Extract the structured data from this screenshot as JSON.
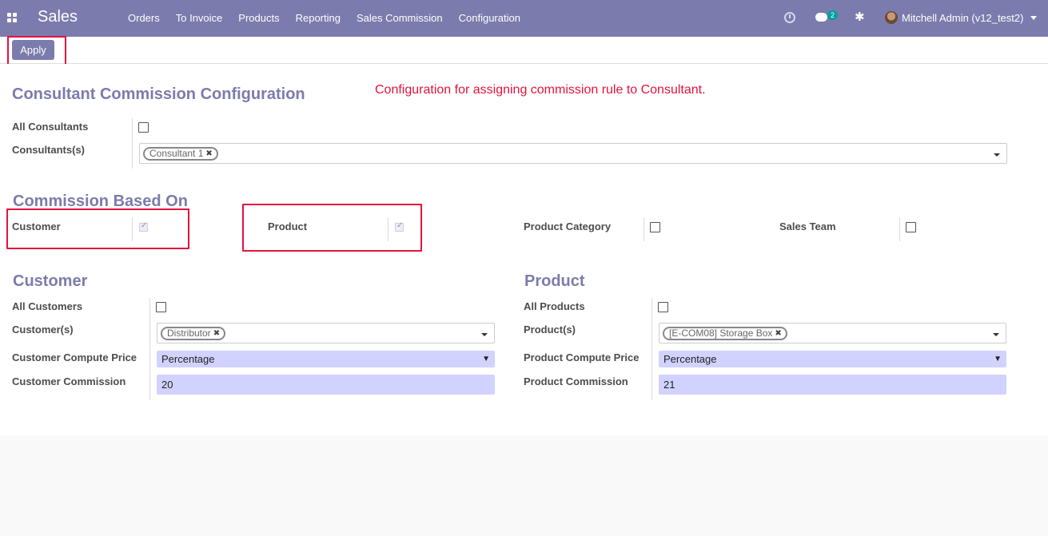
{
  "navbar": {
    "app_name": "Sales",
    "menu": [
      "Orders",
      "To Invoice",
      "Products",
      "Reporting",
      "Sales Commission",
      "Configuration"
    ],
    "chat_count": "2",
    "user": "Mitchell Admin (v12_test2)",
    "bg_color": "#7c7bad"
  },
  "control_panel": {
    "apply_label": "Apply"
  },
  "consultant_section": {
    "title": "Consultant Commission Configuration",
    "note": "Configuration for assigning commission rule to Consultant.",
    "all_consultants_label": "All Consultants",
    "all_consultants_checked": false,
    "consultants_label": "Consultants(s)",
    "consultants_tags": [
      "Consultant 1"
    ]
  },
  "based_on": {
    "title": "Commission Based On",
    "customer_label": "Customer",
    "customer_checked": true,
    "product_label": "Product",
    "product_checked": true,
    "category_label": "Product Category",
    "category_checked": false,
    "sales_team_label": "Sales Team",
    "sales_team_checked": false
  },
  "customer": {
    "title": "Customer",
    "all_label": "All Customers",
    "all_checked": false,
    "list_label": "Customer(s)",
    "tags": [
      "Distributor"
    ],
    "compute_label": "Customer Compute Price",
    "compute_value": "Percentage",
    "commission_label": "Customer Commission",
    "commission_value": "20"
  },
  "product": {
    "title": "Product",
    "all_label": "All Products",
    "all_checked": false,
    "list_label": "Product(s)",
    "tags": [
      "[E-COM08] Storage Box"
    ],
    "compute_label": "Product Compute Price",
    "compute_value": "Percentage",
    "commission_label": "Product Commission",
    "commission_value": "21"
  },
  "colors": {
    "accent": "#7c7bad",
    "highlight": "#e2133d",
    "input_bg": "#d2d2ff"
  }
}
